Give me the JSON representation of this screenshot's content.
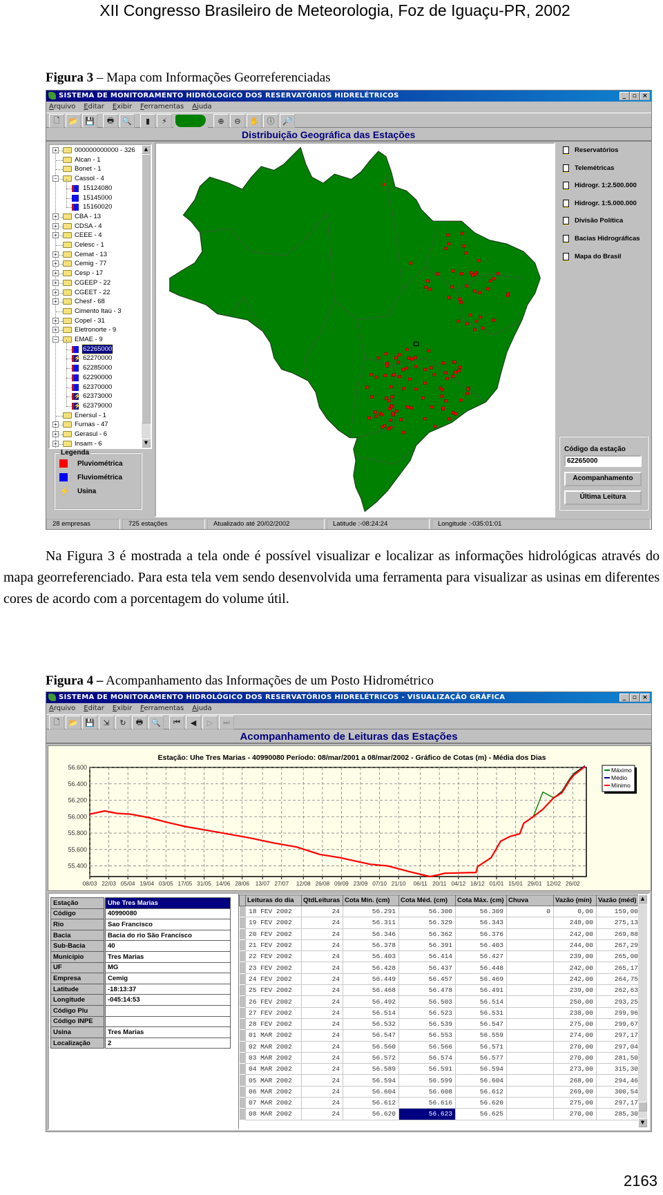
{
  "page": {
    "header": "XII Congresso Brasileiro de Meteorologia, Foz de Iguaçu-PR, 2002",
    "page_number": "2163"
  },
  "figure3": {
    "caption_bold": "Figura 3",
    "caption_text": " – Mapa com Informações Georreferenciadas"
  },
  "window1": {
    "title": "SISTEMA DE MONITORAMENTO HIDRÓLOGICO DOS RESERVATÓRIOS HIDRELÉTRICOS",
    "menu": [
      "Arquivo",
      "Editar",
      "Exibir",
      "Ferramentas",
      "Ajuda"
    ],
    "toolbar": [
      "new-file-icon",
      "open-folder-icon",
      "save-icon",
      "print-icon",
      "print-preview-icon",
      "chart-icon",
      "usina-icon",
      "brazil-map-icon",
      "zoom-in-icon",
      "zoom-out-icon",
      "pan-hand-icon",
      "info-icon",
      "find-icon"
    ],
    "subheader": "Distribuição Geográfica das Estações",
    "tree": [
      {
        "label": "000000000000 - 326",
        "level": 0,
        "expander": "+"
      },
      {
        "label": "Alcan - 1",
        "level": 0,
        "expander": ""
      },
      {
        "label": "Bonet - 1",
        "level": 0,
        "expander": ""
      },
      {
        "label": "Cassol - 4",
        "level": 0,
        "expander": "-"
      },
      {
        "label": "15124080",
        "level": 1,
        "type": "pluvio-fluvio"
      },
      {
        "label": "15145000",
        "level": 1,
        "type": "fluvio"
      },
      {
        "label": "15160020",
        "level": 1,
        "type": "pluvio-fluvio"
      },
      {
        "label": "CBA - 13",
        "level": 0,
        "expander": "+"
      },
      {
        "label": "CDSA - 4",
        "level": 0,
        "expander": "+"
      },
      {
        "label": "CEEE - 4",
        "level": 0,
        "expander": "+"
      },
      {
        "label": "Celesc - 1",
        "level": 0,
        "expander": ""
      },
      {
        "label": "Cemat - 13",
        "level": 0,
        "expander": "+"
      },
      {
        "label": "Cemig - 77",
        "level": 0,
        "expander": "+"
      },
      {
        "label": "Cesp - 17",
        "level": 0,
        "expander": "+"
      },
      {
        "label": "CGEEP - 22",
        "level": 0,
        "expander": "+"
      },
      {
        "label": "CGEET - 22",
        "level": 0,
        "expander": "+"
      },
      {
        "label": "Chesf - 68",
        "level": 0,
        "expander": "+"
      },
      {
        "label": "Cimento Itaú - 3",
        "level": 0,
        "expander": ""
      },
      {
        "label": "Copel - 31",
        "level": 0,
        "expander": "+"
      },
      {
        "label": "Eletronorte - 9",
        "level": 0,
        "expander": "+"
      },
      {
        "label": "EMAE - 9",
        "level": 0,
        "expander": "-"
      },
      {
        "label": "62265000",
        "level": 1,
        "type": "pluvio-fluvio",
        "selected": true
      },
      {
        "label": "62270000",
        "level": 1,
        "type": "usina"
      },
      {
        "label": "62285000",
        "level": 1,
        "type": "pluvio-fluvio"
      },
      {
        "label": "62290000",
        "level": 1,
        "type": "pluvio-fluvio"
      },
      {
        "label": "62370000",
        "level": 1,
        "type": "pluvio-fluvio"
      },
      {
        "label": "62373000",
        "level": 1,
        "type": "usina"
      },
      {
        "label": "62379000",
        "level": 1,
        "type": "usina"
      },
      {
        "label": "Enersul - 1",
        "level": 0,
        "expander": ""
      },
      {
        "label": "Furnas - 47",
        "level": 0,
        "expander": "+"
      },
      {
        "label": "Gerasul - 6",
        "level": 0,
        "expander": "+"
      },
      {
        "label": "Insam - 6",
        "level": 0,
        "expander": "+"
      }
    ],
    "legend": {
      "title": "Legenda",
      "items": [
        {
          "label": "Pluviométrica",
          "color": "#ff0000",
          "icon": "red-square-icon"
        },
        {
          "label": "Fluviométrica",
          "color": "#0000ff",
          "icon": "blue-square-icon"
        },
        {
          "label": "Usina",
          "color": "#e8e040",
          "icon": "lightning-icon"
        }
      ]
    },
    "layers": [
      "Reservatórios",
      "Telemétricas",
      "Hidrogr. 1:2.500.000",
      "Hidrogr. 1:5.000.000",
      "Divisão Política",
      "Bacias Hidrográficas",
      "Mapa do Brasil"
    ],
    "station_code": {
      "label": "Código da estação",
      "value": "62265000"
    },
    "buttons": {
      "follow_up": "Acompanhamento",
      "last_reading": "Última Leitura"
    },
    "status": [
      "28 empresas",
      "725 estações",
      "Atualizado até 20/02/2002",
      "Latitude :-08:24:24",
      "Longitude :-035:01:01"
    ],
    "colors": {
      "map_land": "#008000",
      "station_dot": "#ff0000"
    }
  },
  "paragraph": "Na Figura 3 é mostrada a tela onde é possível visualizar e localizar as informações hidrológicas através do mapa georreferenciado. Para esta tela vem sendo desenvolvida uma ferramenta para visualizar as usinas em diferentes cores de acordo com a porcentagem do volume útil.",
  "figure4": {
    "caption_bold": "Figura 4 –",
    "caption_text": " Acompanhamento das Informações de um Posto Hidrométrico"
  },
  "window2": {
    "title": "SISTEMA DE MONITORAMENTO HIDROLÓGICO DOS RESERVATÓRIOS HIDRELÉTRICOS - VISUALIZAÇÃO GRÁFICA",
    "menu": [
      "Arquivo",
      "Editar",
      "Exibir",
      "Ferramentas",
      "Ajuda"
    ],
    "toolbar": [
      "new-file-icon",
      "open-folder-icon",
      "save-icon",
      "export-icon",
      "refresh-icon",
      "print-icon",
      "print-preview-icon",
      "first-record-icon",
      "previous-record-icon",
      "next-record-icon",
      "last-record-icon"
    ],
    "header": "Acompanhamento de Leituras das Estações",
    "station_info": [
      {
        "label": "Estação",
        "value": "Uhe Tres Marias"
      },
      {
        "label": "Código",
        "value": "40990080"
      },
      {
        "label": "Rio",
        "value": "Sao Francisco"
      },
      {
        "label": "Bacia",
        "value": "Bacia do rio São Francisco"
      },
      {
        "label": "Sub-Bacia",
        "value": "40"
      },
      {
        "label": "Município",
        "value": "Tres Marias"
      },
      {
        "label": "UF",
        "value": "MG"
      },
      {
        "label": "Empresa",
        "value": "Cemig"
      },
      {
        "label": "Latitude",
        "value": "-18:13:37"
      },
      {
        "label": "Longitude",
        "value": "-045:14:53"
      },
      {
        "label": "Código Plu",
        "value": ""
      },
      {
        "label": "Código INPE",
        "value": ""
      },
      {
        "label": "Usina",
        "value": "Tres Marias"
      },
      {
        "label": "Localização",
        "value": "2"
      }
    ],
    "readings": {
      "columns": [
        "Leituras do dia",
        "QtdLeituras",
        "Cota Mín. (cm)",
        "Cota Méd. (cm)",
        "Cota Máx. (cm)",
        "Chuva",
        "Vazão (mín)",
        "Vazão (méd)"
      ],
      "rows": [
        [
          "18 FEV 2002",
          "24",
          "56.291",
          "56.300",
          "56.309",
          "0",
          "0,00",
          "159,00"
        ],
        [
          "19 FEV 2002",
          "24",
          "56.311",
          "56.329",
          "56.343",
          "",
          "248,00",
          "275,13"
        ],
        [
          "20 FEV 2002",
          "24",
          "56.346",
          "56.362",
          "56.376",
          "",
          "242,00",
          "269,88"
        ],
        [
          "21 FEV 2002",
          "24",
          "56.378",
          "56.391",
          "56.403",
          "",
          "244,00",
          "267,29"
        ],
        [
          "22 FEV 2002",
          "24",
          "56.403",
          "56.414",
          "56.427",
          "",
          "239,00",
          "265,00"
        ],
        [
          "23 FEV 2002",
          "24",
          "56.428",
          "56.437",
          "56.448",
          "",
          "242,00",
          "265,17"
        ],
        [
          "24 FEV 2002",
          "24",
          "56.449",
          "56.457",
          "56.469",
          "",
          "242,00",
          "264,75"
        ],
        [
          "25 FEV 2002",
          "24",
          "56.468",
          "56.478",
          "56.491",
          "",
          "239,00",
          "262,63"
        ],
        [
          "26 FEV 2002",
          "24",
          "56.492",
          "56.503",
          "56.514",
          "",
          "250,00",
          "293,25"
        ],
        [
          "27 FEV 2002",
          "24",
          "56.514",
          "56.523",
          "56.531",
          "",
          "238,00",
          "299,96"
        ],
        [
          "28 FEV 2002",
          "24",
          "56.532",
          "56.539",
          "56.547",
          "",
          "275,00",
          "299,67"
        ],
        [
          "01 MAR 2002",
          "24",
          "56.547",
          "56.553",
          "56.559",
          "",
          "274,00",
          "297,17"
        ],
        [
          "02 MAR 2002",
          "24",
          "56.560",
          "56.566",
          "56.571",
          "",
          "270,00",
          "297,04"
        ],
        [
          "03 MAR 2002",
          "24",
          "56.572",
          "56.574",
          "56.577",
          "",
          "270,00",
          "281,50"
        ],
        [
          "04 MAR 2002",
          "24",
          "56.589",
          "56.591",
          "56.594",
          "",
          "273,00",
          "315,30"
        ],
        [
          "05 MAR 2002",
          "24",
          "56.594",
          "56.599",
          "56.604",
          "",
          "268,00",
          "294,46"
        ],
        [
          "06 MAR 2002",
          "24",
          "56.604",
          "56.608",
          "56.612",
          "",
          "269,00",
          "300,54"
        ],
        [
          "07 MAR 2002",
          "24",
          "56.612",
          "56.616",
          "56.620",
          "",
          "275,00",
          "297,17"
        ],
        [
          "08 MAR 2002",
          "24",
          "56.620",
          "56.623",
          "56.625",
          "",
          "270,00",
          "285,30"
        ]
      ],
      "selected_cell": {
        "row": 18,
        "column": 3
      }
    }
  },
  "chart_data": {
    "type": "line",
    "title": "Estação: Uhe Tres Marias - 40990080 Período: 08/mar/2001 a 08/mar/2002 - Gráfico de Cotas (m) - Média dos Dias",
    "xlim": [
      "08/03/2001",
      "08/03/2002"
    ],
    "ylim": [
      55.27,
      56.6
    ],
    "yticks": [
      "56.600",
      "56.400",
      "56.200",
      "56.000",
      "55.800",
      "55.600",
      "55.400"
    ],
    "xticks": [
      "08/03",
      "22/03",
      "05/04",
      "19/04",
      "03/05",
      "17/05",
      "31/05",
      "14/06",
      "28/06",
      "13/07",
      "27/07",
      "12/08",
      "26/08",
      "09/09",
      "23/09",
      "07/10",
      "21/10",
      "06/11",
      "20/11",
      "04/12",
      "18/12",
      "01/01",
      "15/01",
      "29/01",
      "12/02",
      "26/02"
    ],
    "grid": true,
    "legend": "top-right",
    "x": [
      "08/03/2001",
      "19/03/2001",
      "28/03/2001",
      "07/04/2001",
      "20/04/2001",
      "04/05/2001",
      "17/05/2001",
      "31/05/2001",
      "17/06/2001",
      "04/07/2001",
      "21/07/2001",
      "07/08/2001",
      "24/08/2001",
      "08/09/2001",
      "30/09/2001",
      "13/10/2001",
      "29/10/2001",
      "13/11/2001",
      "19/11/2001",
      "24/11/2001",
      "17/12/2001",
      "18/12/2001",
      "28/12/2001",
      "04/01/2002",
      "11/01/2002",
      "18/01/2002",
      "21/01/2002",
      "28/01/2002",
      "04/02/2002",
      "12/02/2002",
      "18/02/2002",
      "24/02/2002",
      "27/02/2002",
      "07/03/2002"
    ],
    "series": [
      {
        "name": "Máximo",
        "color": "#008000",
        "values": [
          56.03,
          56.07,
          56.04,
          56.03,
          55.99,
          55.93,
          55.88,
          55.84,
          55.79,
          55.74,
          55.68,
          55.63,
          55.54,
          55.5,
          55.42,
          55.4,
          55.33,
          55.27,
          55.29,
          55.31,
          55.32,
          55.39,
          55.5,
          55.7,
          55.76,
          55.79,
          55.92,
          56.0,
          56.3,
          56.23,
          56.31,
          56.47,
          56.53,
          56.62
        ]
      },
      {
        "name": "Médio",
        "color": "#0000a0",
        "values": [
          56.03,
          56.07,
          56.04,
          56.03,
          55.99,
          55.93,
          55.88,
          55.84,
          55.79,
          55.74,
          55.68,
          55.63,
          55.54,
          55.5,
          55.42,
          55.4,
          55.33,
          55.27,
          55.29,
          55.31,
          55.32,
          55.39,
          55.5,
          55.7,
          55.76,
          55.79,
          55.92,
          56.0,
          56.09,
          56.23,
          56.3,
          56.46,
          56.52,
          56.62
        ]
      },
      {
        "name": "Mínimo",
        "color": "#ff0000",
        "values": [
          56.03,
          56.07,
          56.04,
          56.03,
          55.99,
          55.93,
          55.88,
          55.84,
          55.79,
          55.74,
          55.68,
          55.63,
          55.54,
          55.5,
          55.42,
          55.4,
          55.33,
          55.27,
          55.29,
          55.31,
          55.32,
          55.39,
          55.5,
          55.7,
          55.76,
          55.79,
          55.92,
          56.0,
          56.09,
          56.23,
          56.29,
          56.45,
          56.51,
          56.61
        ]
      }
    ]
  }
}
